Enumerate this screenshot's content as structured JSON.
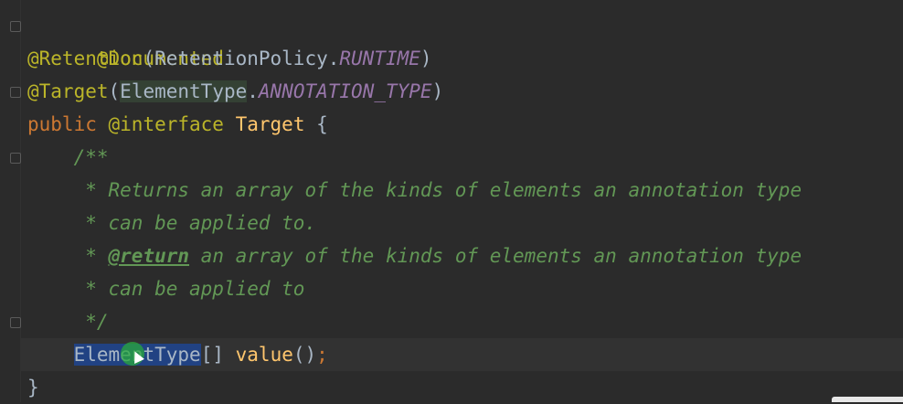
{
  "lines": {
    "l1": {
      "ann": "@Documented"
    },
    "l2": {
      "ann": "@Retention",
      "open": "(RetentionPolicy.",
      "const": "RUNTIME",
      "close": ")"
    },
    "l3": {
      "ann": "@Target",
      "open": "(",
      "cls": "ElementType",
      "dot": ".",
      "const": "ANNOTATION_TYPE",
      "close": ")"
    },
    "l4": {
      "kw": "public",
      "ann": "@interface",
      "name": "Target",
      "brace": "{"
    },
    "l5": {
      "doc": "/**"
    },
    "l6": {
      "doc": " * Returns an array of the kinds of elements an annotation type"
    },
    "l7": {
      "doc": " * can be applied to."
    },
    "l8": {
      "star": " * ",
      "tag": "@return",
      "doc": " an array of the kinds of elements an annotation type"
    },
    "l9": {
      "doc": " * can be applied to"
    },
    "l10": {
      "doc": " */"
    },
    "l11": {
      "type_a": "Ele",
      "type_b": "m",
      "type_c": "entType",
      "brackets": "[]",
      "method": "value",
      "parens": "()",
      "semi": ";"
    },
    "l12": {
      "brace": "}"
    }
  },
  "colors": {
    "background": "#2b2b2b",
    "annotation": "#bbb529",
    "keyword": "#cc7832",
    "class": "#ffc66d",
    "constant": "#9876aa",
    "doc": "#629755",
    "selection": "#214283"
  }
}
